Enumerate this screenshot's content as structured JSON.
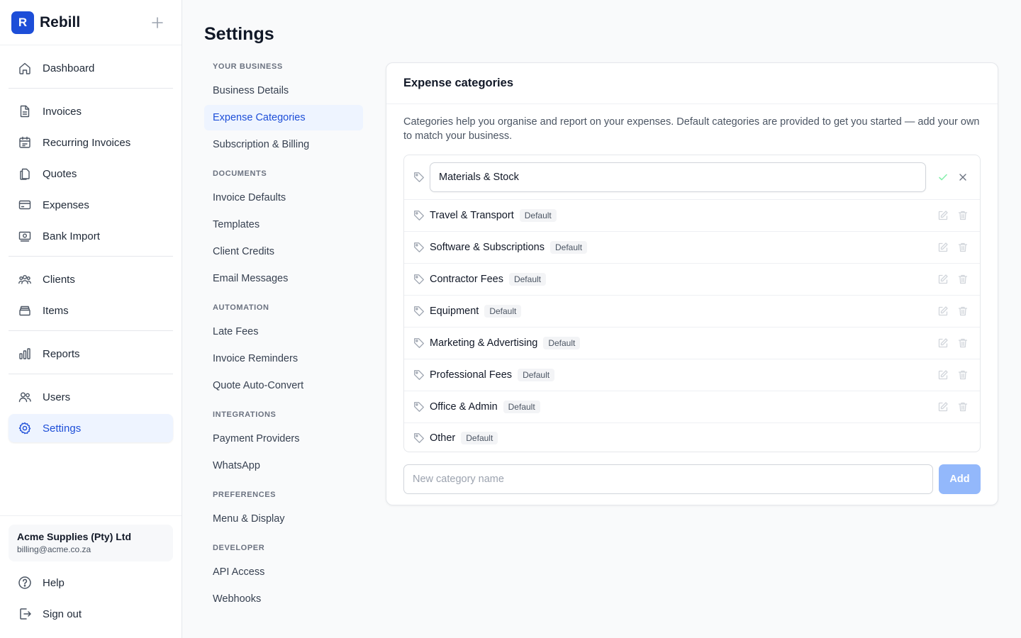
{
  "brand": {
    "logo_letter": "R",
    "name": "Rebill"
  },
  "sidebar": {
    "groups": [
      [
        {
          "label": "Dashboard",
          "icon": "home-icon"
        }
      ],
      [
        {
          "label": "Invoices",
          "icon": "document-icon"
        },
        {
          "label": "Recurring Invoices",
          "icon": "calendar-icon"
        },
        {
          "label": "Quotes",
          "icon": "copy-icon"
        },
        {
          "label": "Expenses",
          "icon": "credit-card-icon"
        },
        {
          "label": "Bank Import",
          "icon": "banknote-icon"
        }
      ],
      [
        {
          "label": "Clients",
          "icon": "users-icon"
        },
        {
          "label": "Items",
          "icon": "archive-icon"
        }
      ],
      [
        {
          "label": "Reports",
          "icon": "bar-chart-icon"
        }
      ],
      [
        {
          "label": "Users",
          "icon": "user-group-icon"
        },
        {
          "label": "Settings",
          "icon": "gear-icon",
          "active": true
        }
      ]
    ],
    "account": {
      "name": "Acme Supplies (Pty) Ltd",
      "email": "billing@acme.co.za"
    },
    "help_label": "Help",
    "signout_label": "Sign out"
  },
  "page": {
    "title": "Settings"
  },
  "settings_nav": {
    "sections": [
      {
        "title": "YOUR BUSINESS",
        "items": [
          "Business Details",
          "Expense Categories",
          "Subscription & Billing"
        ]
      },
      {
        "title": "DOCUMENTS",
        "items": [
          "Invoice Defaults",
          "Templates",
          "Client Credits",
          "Email Messages"
        ]
      },
      {
        "title": "AUTOMATION",
        "items": [
          "Late Fees",
          "Invoice Reminders",
          "Quote Auto-Convert"
        ]
      },
      {
        "title": "INTEGRATIONS",
        "items": [
          "Payment Providers",
          "WhatsApp"
        ]
      },
      {
        "title": "PREFERENCES",
        "items": [
          "Menu & Display"
        ]
      },
      {
        "title": "DEVELOPER",
        "items": [
          "API Access",
          "Webhooks"
        ]
      }
    ],
    "active": "Expense Categories"
  },
  "card": {
    "title": "Expense categories",
    "description": "Categories help you organise and report on your expenses. Default categories are provided to get you started — add your own to match your business.",
    "editing_value": "Materials & Stock",
    "default_badge": "Default",
    "categories": [
      "Travel & Transport",
      "Software & Subscriptions",
      "Contractor Fees",
      "Equipment",
      "Marketing & Advertising",
      "Professional Fees",
      "Office & Admin",
      "Other"
    ],
    "new_placeholder": "New category name",
    "add_label": "Add"
  },
  "colors": {
    "accent": "#1d4ed8",
    "accent_soft": "#eef4ff",
    "add_button": "#93b8fb"
  }
}
